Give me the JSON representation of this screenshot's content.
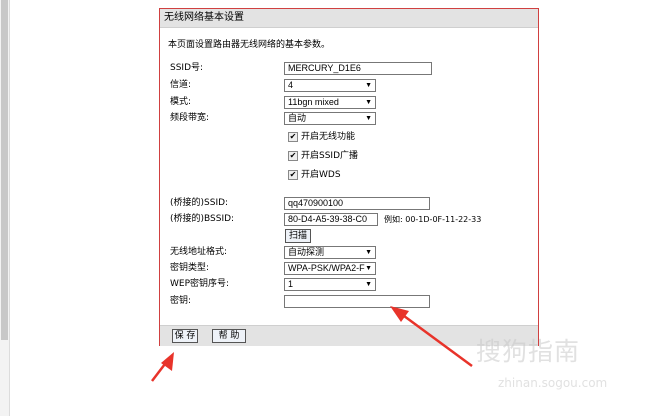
{
  "panel": {
    "title": "无线网络基本设置",
    "intro": "本页面设置路由器无线网络的基本参数。"
  },
  "form": {
    "ssid": {
      "label": "SSID号:",
      "value": "MERCURY_D1E6"
    },
    "channel": {
      "label": "信道:",
      "value": "4"
    },
    "mode": {
      "label": "模式:",
      "value": "11bgn mixed"
    },
    "bandwidth": {
      "label": "频段带宽:",
      "value": "自动"
    },
    "checkboxes": [
      {
        "label": "开启无线功能",
        "checked": true
      },
      {
        "label": "开启SSID广播",
        "checked": true
      },
      {
        "label": "开启WDS",
        "checked": true
      }
    ],
    "bridge_ssid": {
      "label": "(桥接的)SSID:",
      "value": "qq470900100"
    },
    "bridge_bssid": {
      "label": "(桥接的)BSSID:",
      "value": "80-D4-A5-39-38-C0",
      "example": "例如: 00-1D-0F-11-22-33"
    },
    "scan_label": "扫描",
    "addr_format": {
      "label": "无线地址格式:",
      "value": "自动探测"
    },
    "key_type": {
      "label": "密钥类型:",
      "value": "WPA-PSK/WPA2-F"
    },
    "wep_index": {
      "label": "WEP密钥序号:",
      "value": "1"
    },
    "key": {
      "label": "密钥:",
      "value": ""
    }
  },
  "buttons": {
    "save": "保 存",
    "help": "帮 助"
  },
  "watermark": {
    "brand": "搜狗指南",
    "url": "zhinan.sogou.com"
  },
  "colors": {
    "panel_border": "#d04040",
    "arrow": "#e8332a"
  }
}
